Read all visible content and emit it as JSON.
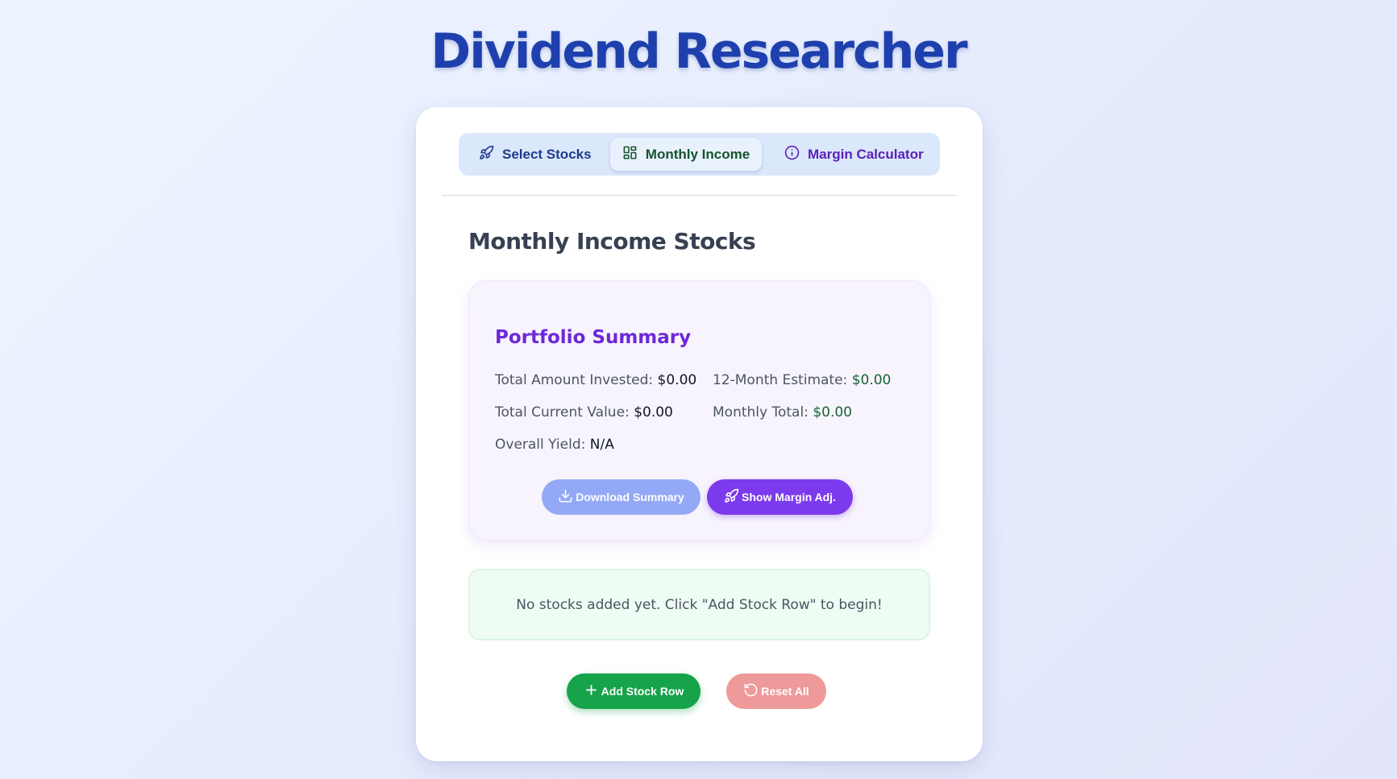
{
  "app": {
    "title": "Dividend Researcher"
  },
  "tabs": {
    "select_stocks": {
      "label": "Select Stocks",
      "icon": "rocket-icon"
    },
    "monthly_income": {
      "label": "Monthly Income",
      "icon": "grid-icon",
      "active": true
    },
    "margin_calculator": {
      "label": "Margin Calculator",
      "icon": "info-icon"
    }
  },
  "section": {
    "title": "Monthly Income Stocks"
  },
  "summary": {
    "title": "Portfolio Summary",
    "total_invested": {
      "label": "Total Amount Invested:",
      "value": "$0.00"
    },
    "estimate_12m": {
      "label": "12-Month Estimate:",
      "value": "$0.00"
    },
    "total_current_value": {
      "label": "Total Current Value:",
      "value": "$0.00"
    },
    "monthly_total": {
      "label": "Monthly Total:",
      "value": "$0.00"
    },
    "overall_yield": {
      "label": "Overall Yield:",
      "value": "N/A"
    },
    "download_button": {
      "label": "Download Summary",
      "icon": "download-icon"
    },
    "margin_button": {
      "label": "Show Margin Adj.",
      "icon": "rocket-icon"
    }
  },
  "empty_state": {
    "message": "No stocks added yet. Click \"Add Stock Row\" to begin!"
  },
  "actions": {
    "add_row": {
      "label": "Add Stock Row",
      "icon": "plus-icon"
    },
    "reset_all": {
      "label": "Reset All",
      "icon": "reset-icon"
    }
  },
  "colors": {
    "title": "#1e40af",
    "accent_purple": "#7c3aed",
    "accent_green": "#16a34a",
    "reset_red": "#ee9a9a",
    "download_blue": "#93a9f6"
  }
}
